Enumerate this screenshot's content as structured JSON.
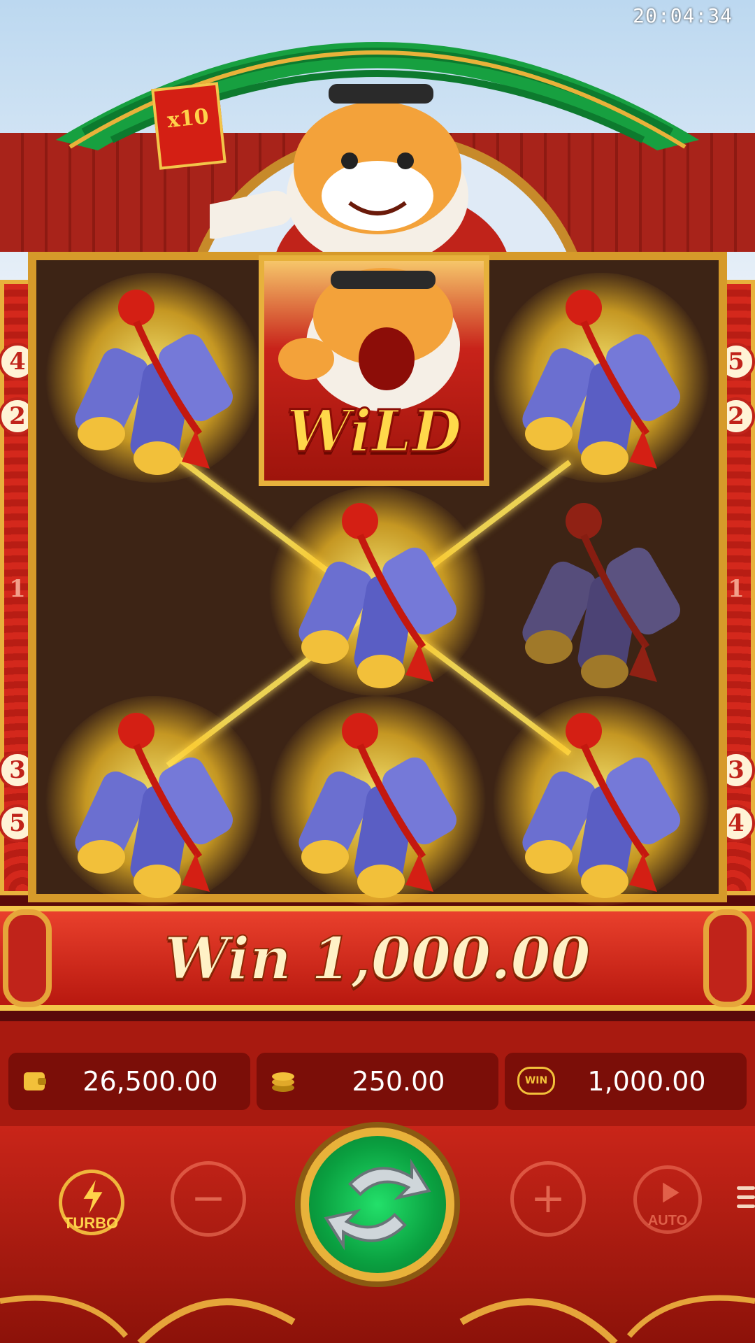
{
  "status_bar": {
    "time": "20:04:34"
  },
  "top": {
    "red_envelope_label": "x10"
  },
  "reels": {
    "wild_label": "WiLD",
    "grid": [
      [
        "firecracker",
        "wild",
        "firecracker"
      ],
      [
        "empty",
        "firecracker",
        "firecracker"
      ],
      [
        "firecracker",
        "firecracker",
        "firecracker"
      ]
    ]
  },
  "paylines": {
    "left": [
      "4",
      "2",
      "1",
      "3",
      "5"
    ],
    "right": [
      "5",
      "2",
      "1",
      "3",
      "4"
    ]
  },
  "win_banner": {
    "label": "Win",
    "amount": "1,000.00"
  },
  "info_bar": {
    "balance": "26,500.00",
    "bet": "250.00",
    "win": "1,000.00",
    "win_icon_text": "WIN"
  },
  "controls": {
    "turbo_label": "TURBO",
    "auto_label": "AUTO",
    "minus_symbol": "−",
    "plus_symbol": "+"
  },
  "colors": {
    "accent_gold": "#e8b23a",
    "frame_red": "#c0231a",
    "spin_green": "#16c456"
  }
}
